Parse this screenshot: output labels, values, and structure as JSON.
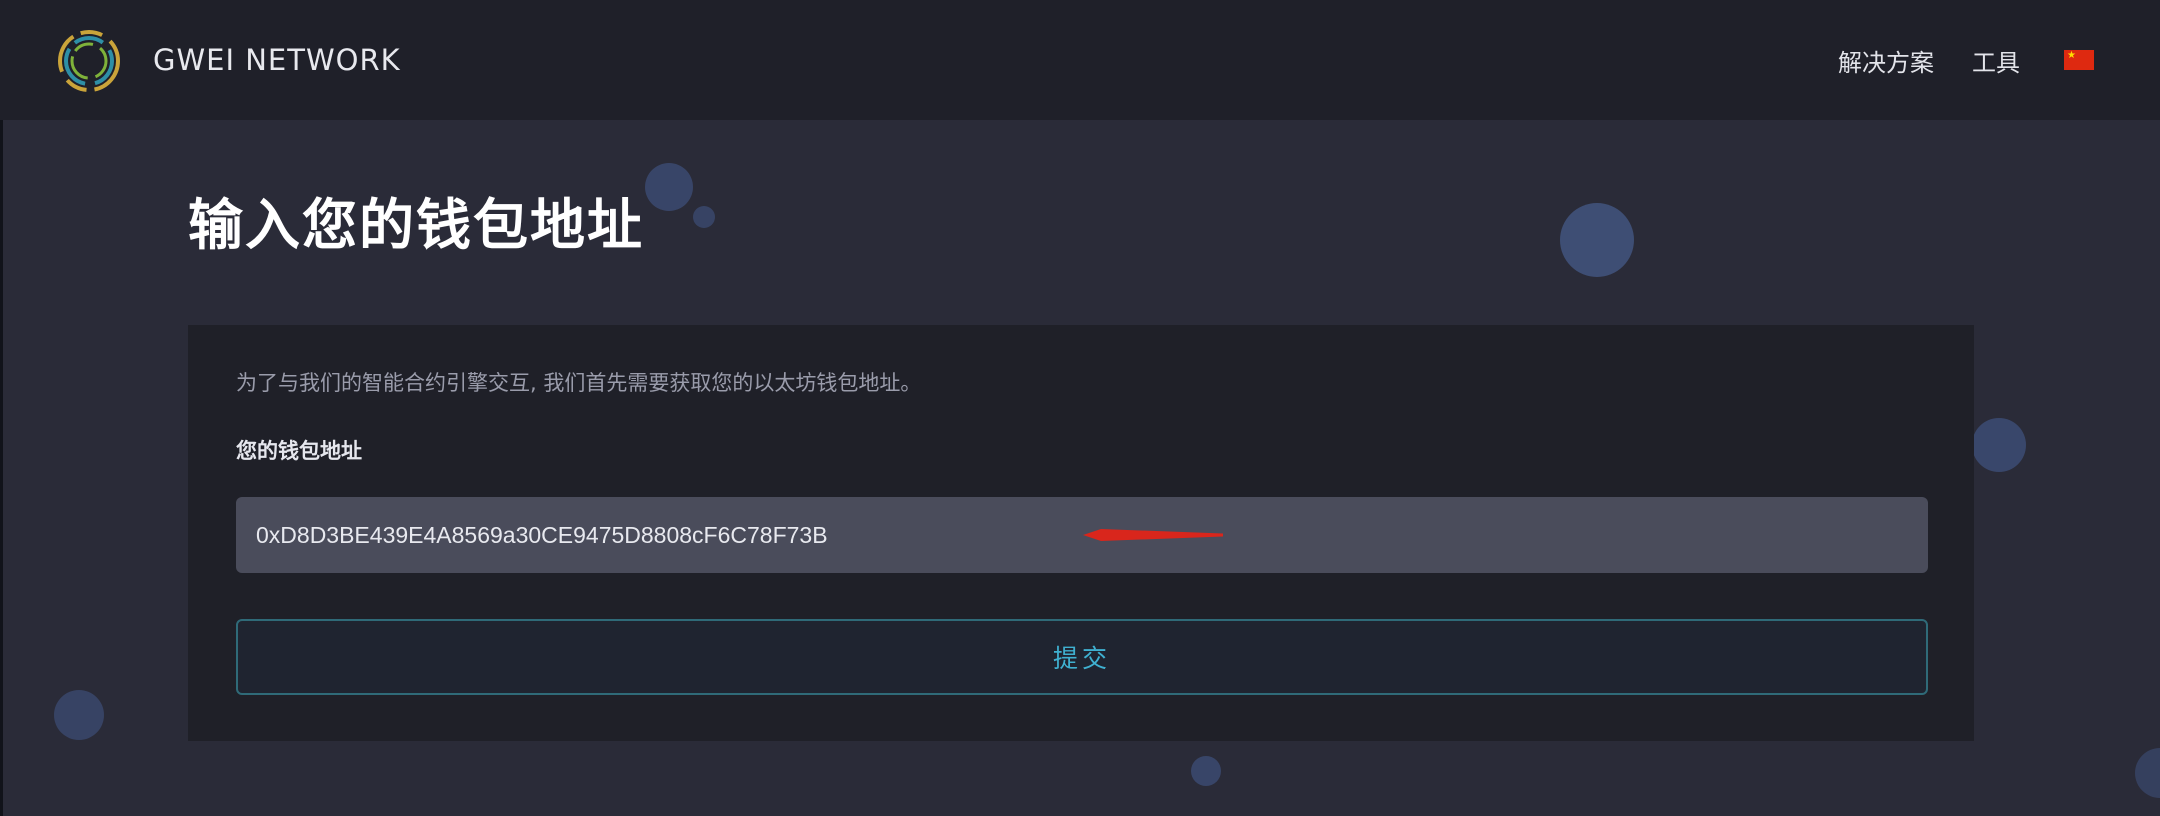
{
  "header": {
    "brand": "GWEI NETWORK",
    "nav": [
      {
        "label": "解决方案"
      },
      {
        "label": "工具"
      }
    ],
    "language_flag": "china-flag-icon"
  },
  "main": {
    "title": "输入您的钱包地址",
    "card": {
      "intro": "为了与我们的智能合约引擎交互, 我们首先需要获取您的以太坊钱包地址。",
      "field_label": "您的钱包地址",
      "address_value": "0xD8D3BE439E4A8569a30CE9475D8808cF6C78F73B",
      "submit_label": "提交"
    }
  },
  "colors": {
    "background": "#2a2b38",
    "header": "#1f2029",
    "card": "#1f2028",
    "input": "#4a4c5b",
    "accent": "#3fb0d0",
    "annotation": "#d9261c"
  }
}
